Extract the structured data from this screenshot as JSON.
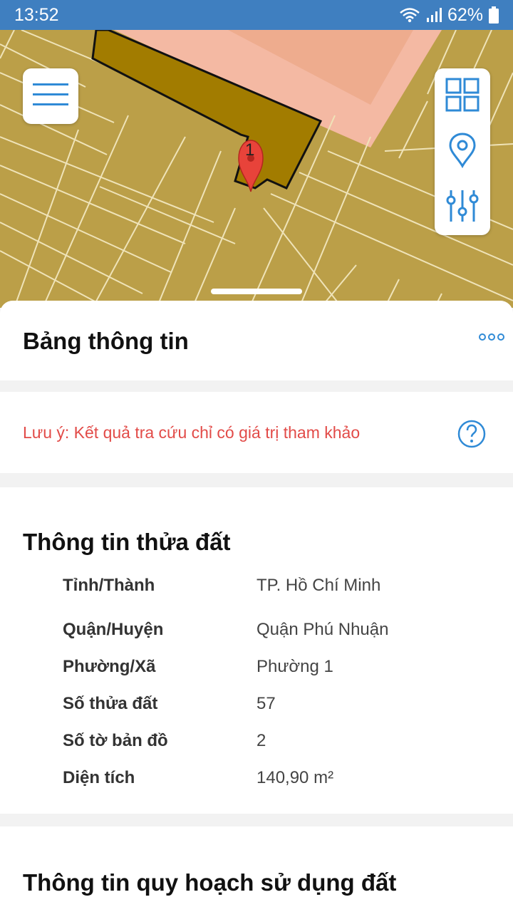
{
  "status_bar": {
    "time": "13:52",
    "battery": "62%",
    "icons": [
      "wifi-icon",
      "signal-icon",
      "battery-icon"
    ]
  },
  "map": {
    "marker_label": "1",
    "controls": [
      "menu-icon",
      "grid-icon",
      "location-pin-icon",
      "sliders-icon"
    ]
  },
  "sheet": {
    "title": "Bảng thông tin",
    "note": "Lưu ý: Kết quả tra cứu chỉ có giá trị tham khảo",
    "parcel": {
      "title": "Thông tin thửa đất",
      "rows": [
        {
          "label": "Tỉnh/Thành",
          "value": "TP. Hồ Chí Minh"
        },
        {
          "label": "Quận/Huyện",
          "value": "Quận Phú Nhuận"
        },
        {
          "label": "Phường/Xã",
          "value": "Phường 1"
        },
        {
          "label": "Số thửa đất",
          "value": "57"
        },
        {
          "label": "Số tờ bản đồ",
          "value": "2"
        },
        {
          "label": "Diện tích",
          "value": "140,90 m²"
        }
      ]
    },
    "planning": {
      "title": "Thông tin quy hoạch sử dụng đất"
    }
  },
  "colors": {
    "status_bar": "#3f7fc0",
    "map_land": "#bb9f48",
    "selected_parcel": "#a27c00",
    "planning_zone": "#f4b9a3",
    "accent": "#2f8ad6",
    "note": "#e24b48"
  }
}
